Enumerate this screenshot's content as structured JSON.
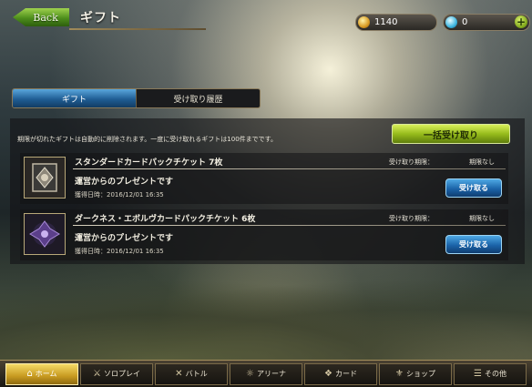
{
  "header": {
    "back_label": "Back",
    "title": "ギフト"
  },
  "currency": {
    "gold": "1140",
    "crystal": "0",
    "add_label": "+"
  },
  "tabs": [
    {
      "label": "ギフト",
      "active": true
    },
    {
      "label": "受け取り履歴",
      "active": false
    }
  ],
  "notice": "期限が切れたギフトは自動的に削除されます。一度に受け取れるギフトは100件までです。",
  "bulk_receive_label": "一括受け取り",
  "gifts": [
    {
      "name": "スタンダードカードパックチケット 7枚",
      "expiry_label": "受け取り期限：",
      "expiry_value": "期限なし",
      "sender": "運営からのプレゼントです",
      "date": "獲得日時：2016/12/01 16:35",
      "receive_label": "受け取る"
    },
    {
      "name": "ダークネス・エボルヴカードパックチケット 6枚",
      "expiry_label": "受け取り期限：",
      "expiry_value": "期限なし",
      "sender": "運営からのプレゼントです",
      "date": "獲得日時：2016/12/01 16:35",
      "receive_label": "受け取る"
    }
  ],
  "nav": [
    {
      "label": "ホーム",
      "icon": "home-icon",
      "active": true
    },
    {
      "label": "ソロプレイ",
      "icon": "swords-icon",
      "active": false
    },
    {
      "label": "バトル",
      "icon": "battle-icon",
      "active": false
    },
    {
      "label": "アリーナ",
      "icon": "arena-icon",
      "active": false
    },
    {
      "label": "カード",
      "icon": "card-icon",
      "active": false
    },
    {
      "label": "ショップ",
      "icon": "shop-icon",
      "active": false
    },
    {
      "label": "その他",
      "icon": "other-icon",
      "active": false
    }
  ]
}
